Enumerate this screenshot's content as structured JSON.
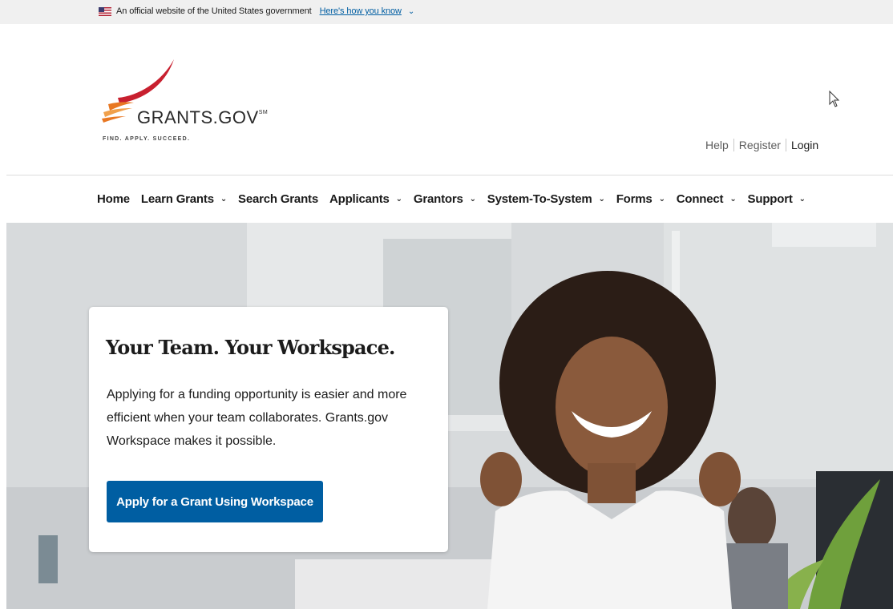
{
  "gov_banner": {
    "text": "An official website of the United States government",
    "link": "Here's how you know",
    "chevron_icon": "chevron-down-icon"
  },
  "logo": {
    "name": "GRANTS.GOV",
    "mark": "SM",
    "tagline": "FIND. APPLY. SUCCEED.",
    "brand_colors": {
      "red": "#c8202f",
      "orange": "#e87722"
    }
  },
  "utility_nav": {
    "help": "Help",
    "register": "Register",
    "login": "Login"
  },
  "main_nav": [
    {
      "label": "Home",
      "has_dropdown": false
    },
    {
      "label": "Learn Grants",
      "has_dropdown": true
    },
    {
      "label": "Search Grants",
      "has_dropdown": false
    },
    {
      "label": "Applicants",
      "has_dropdown": true
    },
    {
      "label": "Grantors",
      "has_dropdown": true
    },
    {
      "label": "System-To-System",
      "has_dropdown": true
    },
    {
      "label": "Forms",
      "has_dropdown": true
    },
    {
      "label": "Connect",
      "has_dropdown": true
    },
    {
      "label": "Support",
      "has_dropdown": true
    }
  ],
  "hero": {
    "title": "Your Team. Your Workspace.",
    "body": "Applying for a funding opportunity is easier and more efficient when your team collaborates. Grants.gov Workspace makes it possible.",
    "button_label": "Apply for a Grant Using Workspace",
    "button_color": "#005ea2"
  },
  "colors": {
    "link": "#005ea2",
    "banner_bg": "#f0f0f0"
  }
}
